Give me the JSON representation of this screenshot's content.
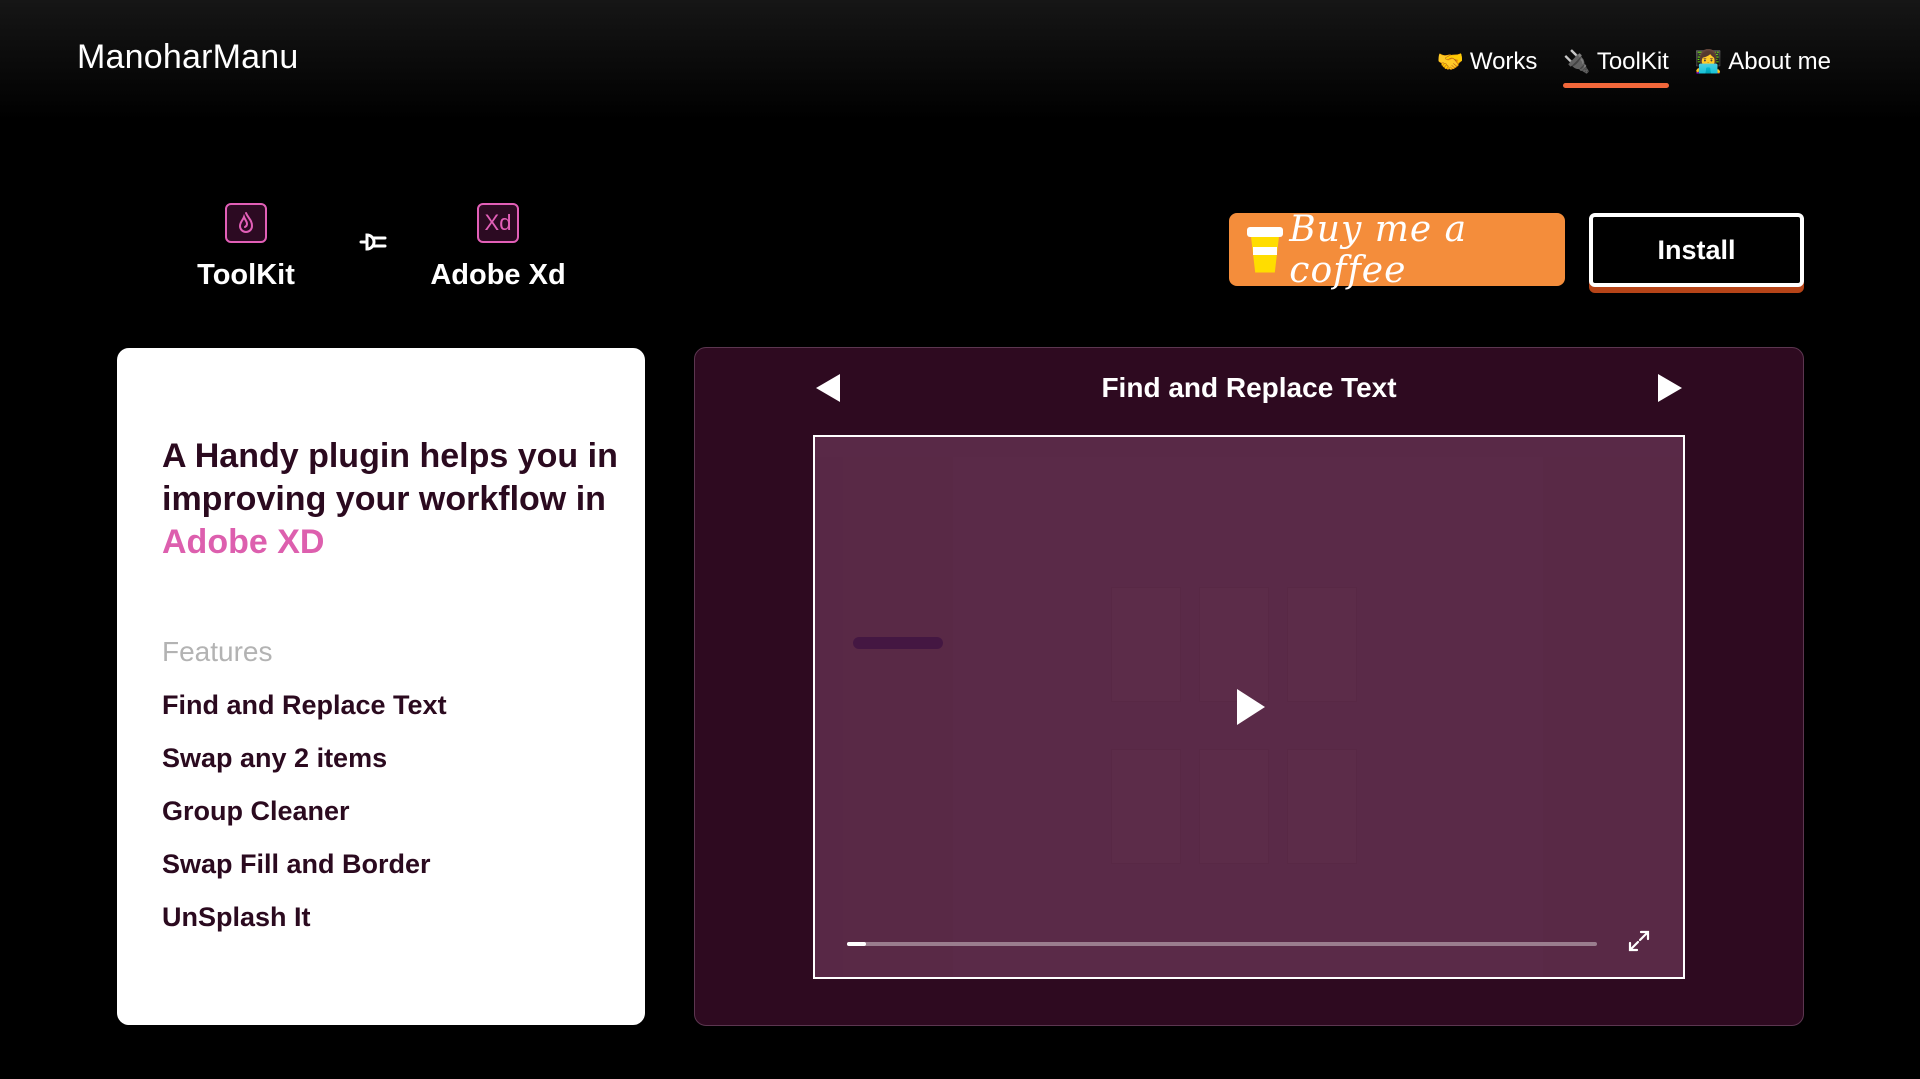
{
  "header": {
    "logo": "ManoharManu",
    "nav": [
      {
        "label": "Works",
        "emoji": "🤝",
        "active": false
      },
      {
        "label": "ToolKit",
        "emoji": "🔌",
        "active": true
      },
      {
        "label": "About me",
        "emoji": "👩‍💻",
        "active": false
      }
    ]
  },
  "plugin": {
    "toolkit_label": "ToolKit",
    "toolkit_icon": "flame-icon",
    "xd_label": "Adobe Xd",
    "xd_icon_text": "Xd",
    "connector_icon": "plug-icon"
  },
  "actions": {
    "coffee_label": "Buy me a coffee",
    "install_label": "Install"
  },
  "card": {
    "headline": "A Handy plugin helps you in improving your workflow in",
    "headline_accent": "Adobe XD",
    "features_title": "Features",
    "features": [
      "Find and Replace Text",
      "Swap any 2 items",
      "Group Cleaner",
      "Swap Fill and Border",
      "UnSplash It"
    ]
  },
  "video": {
    "title": "Find and Replace Text",
    "progress": 0.025
  },
  "colors": {
    "accent_pink": "#dd5fae",
    "nav_underline": "#f2673a",
    "panel_bg": "#2e0a20",
    "coffee_orange": "#f48d3b"
  }
}
